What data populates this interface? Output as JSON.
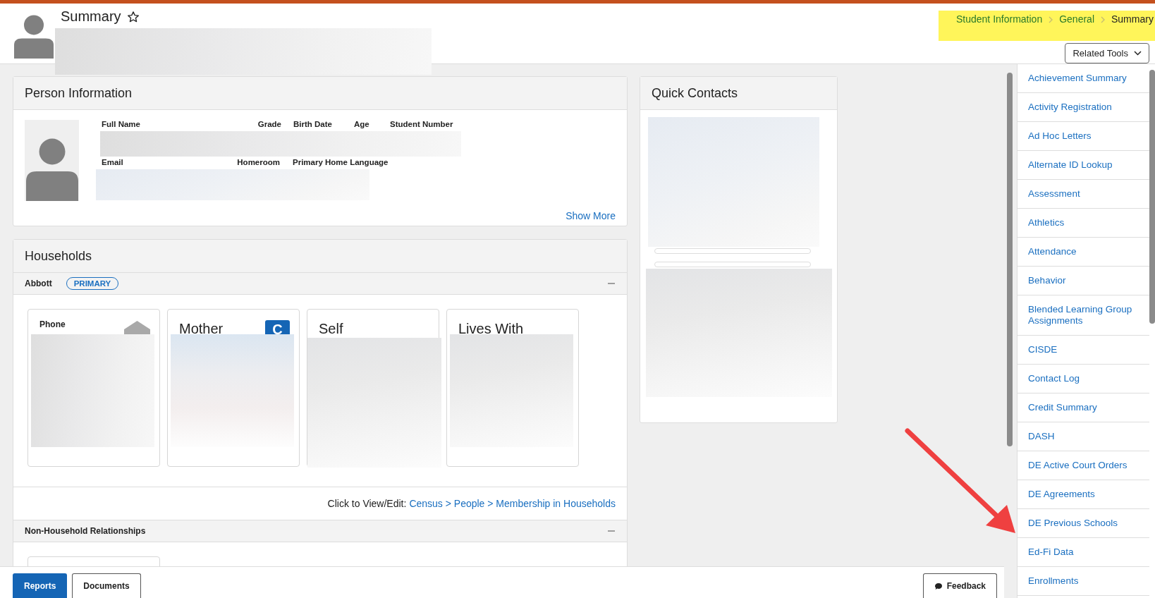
{
  "header": {
    "title": "Summary",
    "favorite": false,
    "breadcrumb": [
      {
        "label": "Student Information",
        "current": false
      },
      {
        "label": "General",
        "current": false
      },
      {
        "label": "Summary",
        "current": true
      }
    ],
    "related_tools_button": "Related Tools"
  },
  "person_information": {
    "title": "Person Information",
    "labels_row_1": [
      "Full Name",
      "Grade",
      "Birth Date",
      "Age",
      "Student Number"
    ],
    "labels_row_2": [
      "Email",
      "Homeroom",
      "Primary Home Language"
    ],
    "show_more": "Show More"
  },
  "households": {
    "title": "Households",
    "household": {
      "name": "Abbott",
      "badge": "PRIMARY",
      "expanded": true
    },
    "cards": [
      {
        "kind": "label",
        "title": "Phone"
      },
      {
        "kind": "title",
        "title": "Mother",
        "badge": "C"
      },
      {
        "kind": "title",
        "title": "Self"
      },
      {
        "kind": "title",
        "title": "Lives With"
      }
    ],
    "footer_prefix": "Click to View/Edit:",
    "footer_link": "Census > People > Membership in Households"
  },
  "non_household": {
    "title": "Non-Household Relationships",
    "expanded": true
  },
  "quick_contacts": {
    "title": "Quick Contacts"
  },
  "related_tools": [
    "Achievement Summary",
    "Activity Registration",
    "Ad Hoc Letters",
    "Alternate ID Lookup",
    "Assessment",
    "Athletics",
    "Attendance",
    "Behavior",
    "Blended Learning Group Assignments",
    "CISDE",
    "Contact Log",
    "Credit Summary",
    "DASH",
    "DE Active Court Orders",
    "DE Agreements",
    "DE Previous Schools",
    "Ed-Fi Data",
    "Enrollments"
  ],
  "bottom_bar": {
    "buttons": [
      {
        "label": "Reports",
        "selected": true
      },
      {
        "label": "Documents",
        "selected": false
      }
    ],
    "feedback": "Feedback"
  }
}
